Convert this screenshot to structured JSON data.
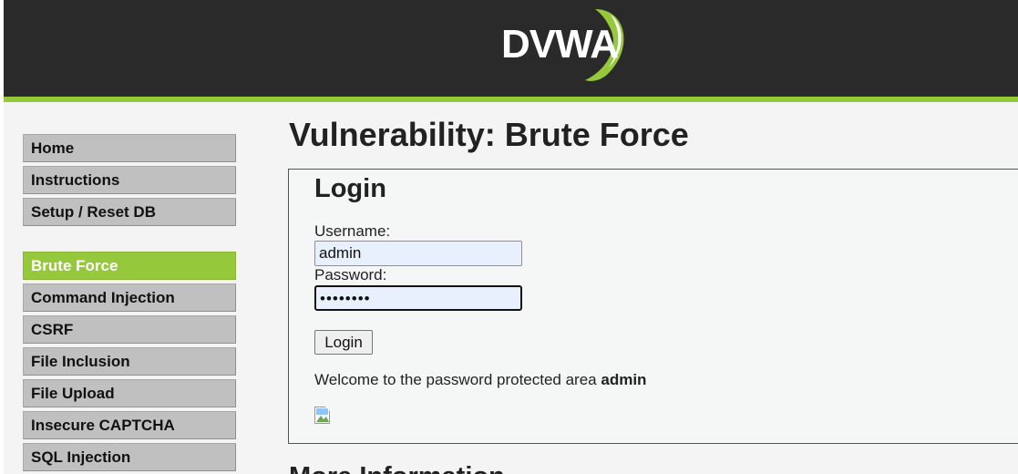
{
  "header": {
    "logo_text": "DVWA"
  },
  "sidebar": {
    "groups": [
      {
        "items": [
          {
            "label": "Home"
          },
          {
            "label": "Instructions"
          },
          {
            "label": "Setup / Reset DB"
          }
        ]
      },
      {
        "items": [
          {
            "label": "Brute Force",
            "selected": true
          },
          {
            "label": "Command Injection"
          },
          {
            "label": "CSRF"
          },
          {
            "label": "File Inclusion"
          },
          {
            "label": "File Upload"
          },
          {
            "label": "Insecure CAPTCHA"
          },
          {
            "label": "SQL Injection"
          }
        ]
      }
    ]
  },
  "main": {
    "title": "Vulnerability: Brute Force",
    "login": {
      "heading": "Login",
      "username_label": "Username:",
      "username_value": "admin",
      "password_label": "Password:",
      "password_masked": "••••••••",
      "button_label": "Login",
      "welcome_prefix": "Welcome to the password protected area ",
      "welcome_user": "admin"
    },
    "more_info_title": "More Information"
  },
  "colors": {
    "header_bg": "#2a2a2a",
    "accent_green": "#96c83c",
    "menu_bg": "#c0c0c0",
    "input_autofill_bg": "#e8f0fe"
  }
}
